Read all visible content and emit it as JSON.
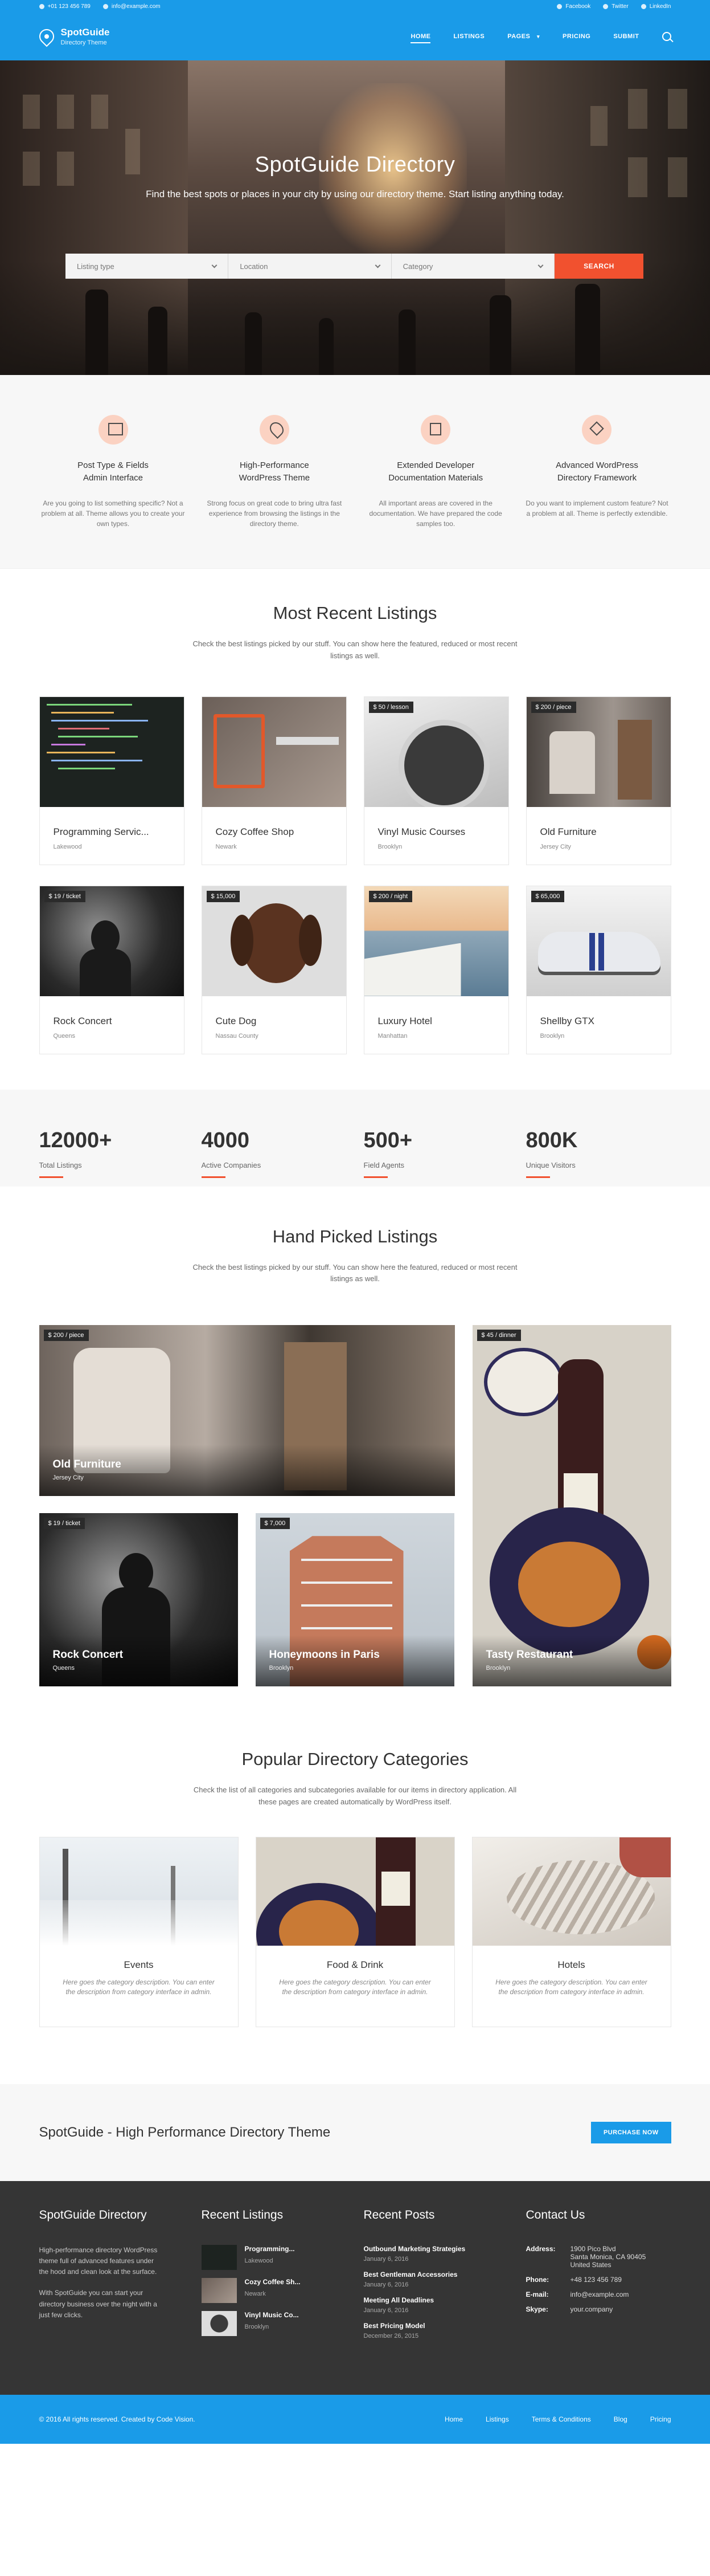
{
  "topbar": {
    "phone": "+01 123 456 789",
    "email": "info@example.com",
    "facebook": "Facebook",
    "twitter": "Twitter",
    "linkedin": "LinkedIn"
  },
  "header": {
    "logo_title": "SpotGuide",
    "logo_sub": "Directory Theme",
    "nav": [
      "HOME",
      "LISTINGS",
      "PAGES",
      "PRICING",
      "SUBMIT"
    ]
  },
  "hero": {
    "title": "SpotGuide Directory",
    "subtitle": "Find the best spots or places in your city by using our directory theme. Start listing anything today.",
    "type_ph": "Listing type",
    "location_ph": "Location",
    "category_ph": "Category",
    "search_btn": "SEARCH"
  },
  "features": [
    {
      "title": "Post Type & Fields\nAdmin Interface",
      "desc": "Are you going to list something specific? Not a problem at all. Theme allows you to create your own types."
    },
    {
      "title": "High-Performance\nWordPress Theme",
      "desc": "Strong focus on great code to bring ultra fast experience from browsing the listings in the directory theme."
    },
    {
      "title": "Extended Developer\nDocumentation Materials",
      "desc": "All important areas are covered in the documentation. We have prepared the code samples too."
    },
    {
      "title": "Advanced WordPress\nDirectory Framework",
      "desc": "Do you want to implement custom feature? Not a problem at all. Theme is perfectly extendible."
    }
  ],
  "recent": {
    "title": "Most Recent Listings",
    "desc": "Check the best listings picked by our stuff. You can show here the featured, reduced or most recent listings as well.",
    "items": [
      {
        "title": "Programming Servic...",
        "loc": "Lakewood",
        "price": ""
      },
      {
        "title": "Cozy Coffee Shop",
        "loc": "Newark",
        "price": ""
      },
      {
        "title": "Vinyl Music Courses",
        "loc": "Brooklyn",
        "price": "$ 50 / lesson"
      },
      {
        "title": "Old Furniture",
        "loc": "Jersey City",
        "price": "$ 200 / piece"
      },
      {
        "title": "Rock Concert",
        "loc": "Queens",
        "price": "$ 19 / ticket"
      },
      {
        "title": "Cute Dog",
        "loc": "Nassau County",
        "price": "$ 15,000"
      },
      {
        "title": "Luxury Hotel",
        "loc": "Manhattan",
        "price": "$ 200 / night"
      },
      {
        "title": "Shellby GTX",
        "loc": "Brooklyn",
        "price": "$ 65,000"
      }
    ]
  },
  "stats": [
    {
      "n": "12000+",
      "l": "Total Listings"
    },
    {
      "n": "4000",
      "l": "Active Companies"
    },
    {
      "n": "500+",
      "l": "Field Agents"
    },
    {
      "n": "800K",
      "l": "Unique Visitors"
    }
  ],
  "hand": {
    "title": "Hand Picked Listings",
    "desc": "Check the best listings picked by our stuff. You can show here the featured, reduced or most recent listings as well.",
    "items": [
      {
        "title": "Old Furniture",
        "loc": "Jersey City",
        "price": "$ 200 / piece"
      },
      {
        "title": "Tasty Restaurant",
        "loc": "Brooklyn",
        "price": "$ 45 / dinner"
      },
      {
        "title": "Rock Concert",
        "loc": "Queens",
        "price": "$ 19 / ticket"
      },
      {
        "title": "Honeymoons in Paris",
        "loc": "Brooklyn",
        "price": "$ 7,000"
      }
    ]
  },
  "cats": {
    "title": "Popular Directory Categories",
    "desc": "Check the list of all categories and subcategories available for our items in directory application. All these pages are created automatically by WordPress itself.",
    "items": [
      {
        "title": "Events",
        "desc": "Here goes the category description. You can enter the description from category interface in admin."
      },
      {
        "title": "Food & Drink",
        "desc": "Here goes the category description. You can enter the description from category interface in admin."
      },
      {
        "title": "Hotels",
        "desc": "Here goes the category description. You can enter the description from category interface in admin."
      }
    ]
  },
  "cta": {
    "title": "SpotGuide - High Performance Directory Theme",
    "btn": "PURCHASE NOW"
  },
  "footer": {
    "about_h": "SpotGuide Directory",
    "about_1": "High-performance directory WordPress theme full of advanced features under the hood and clean look at the surface.",
    "about_2": "With SpotGuide you can start your directory business over the night with a just few clicks.",
    "recent_h": "Recent Listings",
    "recent": [
      {
        "t": "Programming...",
        "s": "Lakewood"
      },
      {
        "t": "Cozy Coffee Sh...",
        "s": "Newark"
      },
      {
        "t": "Vinyl Music Co...",
        "s": "Brooklyn"
      }
    ],
    "posts_h": "Recent Posts",
    "posts": [
      {
        "t": "Outbound Marketing Strategies",
        "d": "January 6, 2016"
      },
      {
        "t": "Best Gentleman Accessories",
        "d": "January 6, 2016"
      },
      {
        "t": "Meeting All Deadlines",
        "d": "January 6, 2016"
      },
      {
        "t": "Best Pricing Model",
        "d": "December 26, 2015"
      }
    ],
    "contact_h": "Contact Us",
    "address_l": "Address:",
    "address": "1900 Pico Blvd\nSanta Monica, CA 90405\nUnited States",
    "phone_l": "Phone:",
    "phone": "+48 123 456 789",
    "email_l": "E-mail:",
    "email": "info@example.com",
    "skype_l": "Skype:",
    "skype": "your.company"
  },
  "bottom": {
    "copy": "© 2016 All rights reserved. Created by Code Vision.",
    "nav": [
      "Home",
      "Listings",
      "Terms & Conditions",
      "Blog",
      "Pricing"
    ]
  },
  "colors": {
    "brand": "#1a9be8",
    "accent": "#f1512f"
  }
}
